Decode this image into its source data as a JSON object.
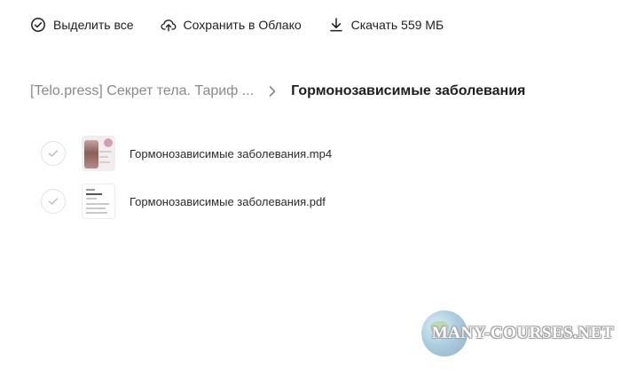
{
  "toolbar": {
    "select_all_label": "Выделить все",
    "save_cloud_label": "Сохранить в Облако",
    "download_label": "Скачать 559 МБ"
  },
  "breadcrumb": {
    "parent": "[Telo.press] Секрет тела. Тариф ...",
    "current": "Гормонозависимые заболевания"
  },
  "files": [
    {
      "name": "Гормонозависимые заболевания.mp4",
      "type": "video"
    },
    {
      "name": "Гормонозависимые заболевания.pdf",
      "type": "pdf"
    }
  ],
  "watermark": {
    "text": "MANY-COURSES.NET"
  },
  "icons": {
    "select_all": "check-circle-icon",
    "save_cloud": "cloud-upload-icon",
    "download": "download-icon",
    "separator": "chevron-right-icon",
    "row_check": "check-icon"
  }
}
